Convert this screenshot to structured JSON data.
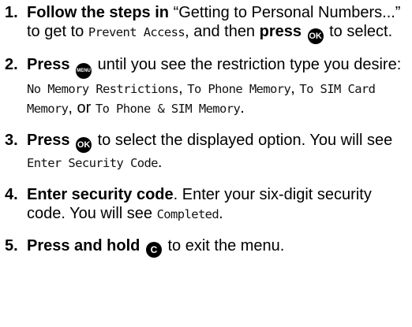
{
  "steps": [
    {
      "number": "1.",
      "bold_lead": "Follow the steps in",
      "text_a": " “Getting to Personal Numbers...” to get to ",
      "screen_a": "Prevent Access",
      "text_b": ", and then ",
      "bold_press": "press",
      "key": "OK",
      "text_c": " to select."
    },
    {
      "number": "2.",
      "bold_lead": "Press",
      "key": "MENU",
      "text_a": " until you see the restriction type you desire: ",
      "options": [
        "No Memory Restrictions",
        "To Phone Memory",
        "To SIM Card Memory",
        "To Phone & SIM Memory"
      ],
      "sep_1": ", ",
      "sep_2": ", ",
      "sep_3": ", or ",
      "text_end": "."
    },
    {
      "number": "3.",
      "bold_lead": "Press",
      "key": "OK",
      "text_a": " to select the displayed option. You will see ",
      "screen_a": "Enter Security Code",
      "text_end": "."
    },
    {
      "number": "4.",
      "bold_lead": "Enter security code",
      "text_a": ". Enter your six-digit security code. You will see ",
      "screen_a": "Completed",
      "text_end": "."
    },
    {
      "number": "5.",
      "bold_lead": "Press and hold",
      "key": "C",
      "text_a": " to exit the menu."
    }
  ]
}
